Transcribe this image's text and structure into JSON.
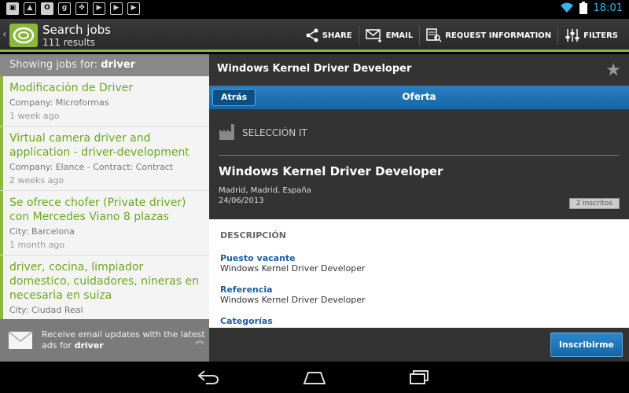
{
  "status_bar": {
    "notification_icons": [
      "image-icon",
      "gallery-icon",
      "outlook-icon",
      "gplus-icon",
      "clover-icon",
      "play-icon",
      "play-icon",
      "play-icon"
    ],
    "time": "18:01"
  },
  "action_bar": {
    "title": "Search jobs",
    "subtitle": "111 results",
    "actions": [
      {
        "label": "SHARE",
        "icon": "share-icon"
      },
      {
        "label": "EMAIL",
        "icon": "email-icon"
      },
      {
        "label": "REQUEST INFORMATION",
        "icon": "request-info-icon"
      },
      {
        "label": "FILTERS",
        "icon": "filters-icon"
      }
    ]
  },
  "results": {
    "showing_prefix": "Showing jobs for:",
    "query": "driver",
    "jobs": [
      {
        "title": "Modificación de Driver",
        "company": "Company: Microformas",
        "age": "1 week ago"
      },
      {
        "title": "Virtual camera driver and application - driver-development",
        "company": "Company: Elance - Contract: Contract",
        "age": "2 weeks ago"
      },
      {
        "title": "Se ofrece chofer (Private driver) con Mercedes Viano 8 plazas",
        "company": "City: Barcelona",
        "age": "1 month ago"
      },
      {
        "title": "driver, cocina, limpiador domestico, cuidadores, nineras en necesaria en suiza",
        "company": "City: Ciudad Real",
        "age": ""
      }
    ],
    "email_updates": {
      "text": "Receive email updates with the latest ads for",
      "query": "driver"
    }
  },
  "detail": {
    "header_title": "Windows Kernel Driver Developer",
    "nav_back": "Atrás",
    "nav_title": "Oferta",
    "company": "SELECCIÓN IT",
    "job_title": "Windows Kernel Driver Developer",
    "location": "Madrid, Madrid, España",
    "date": "24/06/2013",
    "applicants": "2 inscritos",
    "section_title": "DESCRIPCIÓN",
    "fields": [
      {
        "label": "Puesto vacante",
        "value": "Windows Kernel Driver Developer"
      },
      {
        "label": "Referencia",
        "value": "Windows Kernel Driver Developer"
      },
      {
        "label": "Categorías",
        "value": ""
      }
    ],
    "apply_label": "Inscribirme"
  },
  "colors": {
    "accent_green": "#8ab83a",
    "link_blue": "#1d5fa0",
    "button_blue": "#1566a6"
  }
}
